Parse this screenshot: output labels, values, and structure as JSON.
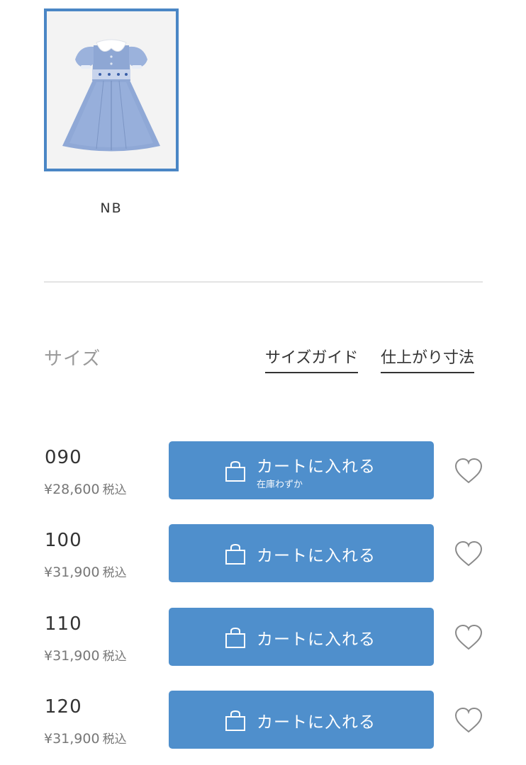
{
  "colors": {
    "accent": "#4f8fcc",
    "swatch_border": "#4a86c5",
    "text": "#333333",
    "muted": "#9a9a9a"
  },
  "color_option": {
    "image": "blue-dress-thumbnail",
    "label": "NB",
    "selected": true
  },
  "size_section": {
    "heading": "サイズ",
    "links": {
      "size_guide": "サイズガイド",
      "finished_dimensions": "仕上がり寸法"
    }
  },
  "sizes": [
    {
      "size": "090",
      "price": "¥28,600",
      "tax": "税込",
      "button": "カートに入れる",
      "stock_note": "在庫わずか",
      "icon": "shopping-bag-icon",
      "fav_icon": "heart-icon"
    },
    {
      "size": "100",
      "price": "¥31,900",
      "tax": "税込",
      "button": "カートに入れる",
      "icon": "shopping-bag-icon",
      "fav_icon": "heart-icon"
    },
    {
      "size": "110",
      "price": "¥31,900",
      "tax": "税込",
      "button": "カートに入れる",
      "icon": "shopping-bag-icon",
      "fav_icon": "heart-icon"
    },
    {
      "size": "120",
      "price": "¥31,900",
      "tax": "税込",
      "button": "カートに入れる",
      "icon": "shopping-bag-icon",
      "fav_icon": "heart-icon"
    }
  ]
}
